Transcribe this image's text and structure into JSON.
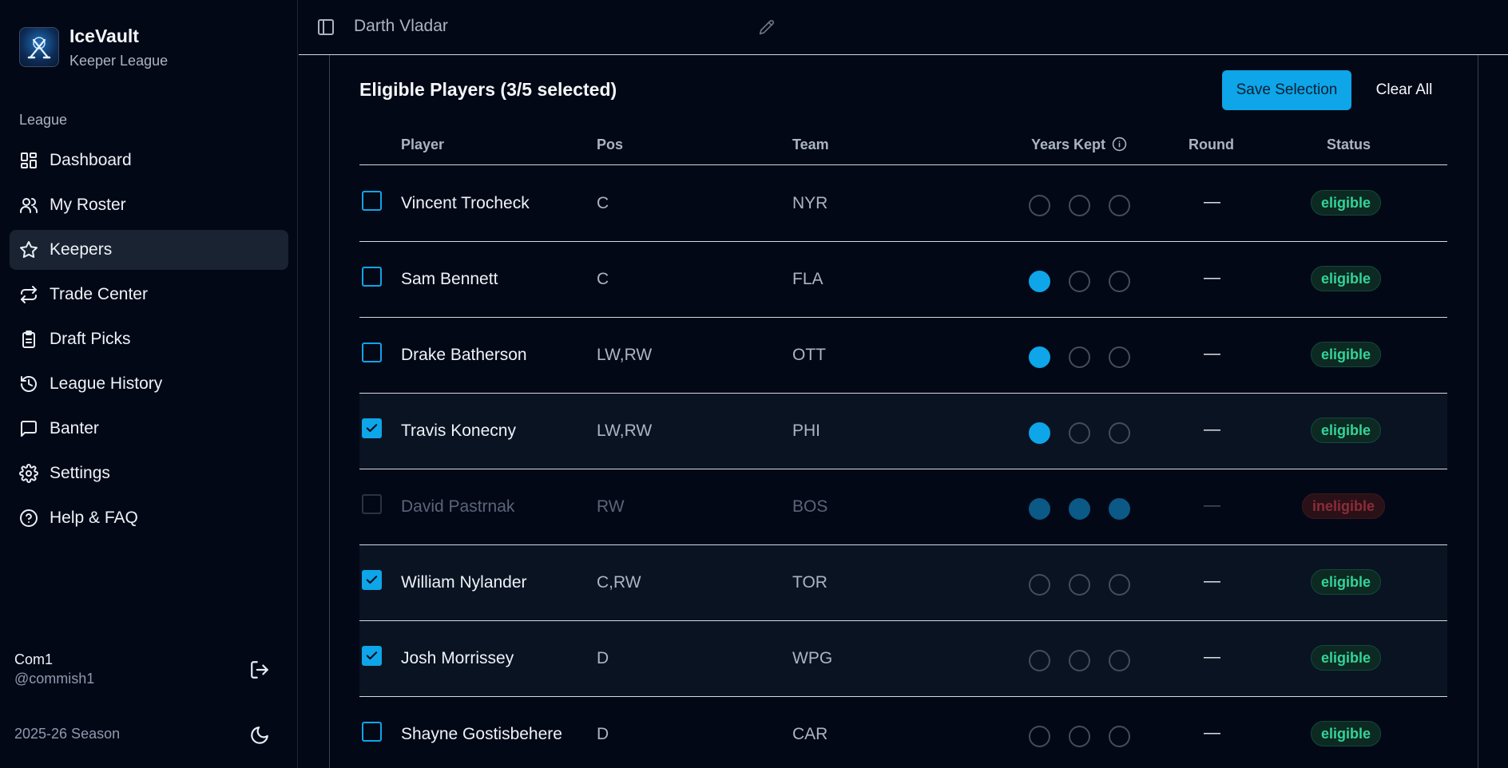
{
  "app": {
    "name": "IceVault",
    "subtitle": "Keeper League"
  },
  "sidebar": {
    "section_label": "League",
    "items": [
      {
        "label": "Dashboard",
        "icon": "dashboard-icon"
      },
      {
        "label": "My Roster",
        "icon": "users-icon"
      },
      {
        "label": "Keepers",
        "icon": "star-icon",
        "active": true
      },
      {
        "label": "Trade Center",
        "icon": "arrows-exchange-icon"
      },
      {
        "label": "Draft Picks",
        "icon": "clipboard-icon"
      },
      {
        "label": "League History",
        "icon": "history-icon"
      },
      {
        "label": "Banter",
        "icon": "chat-icon"
      },
      {
        "label": "Settings",
        "icon": "gear-icon"
      },
      {
        "label": "Help & FAQ",
        "icon": "help-icon"
      }
    ],
    "user": {
      "name": "Com1",
      "handle": "@commish1"
    },
    "season": "2025-26 Season"
  },
  "header": {
    "title": "Darth Vladar"
  },
  "keepers": {
    "title": "Eligible Players (3/5 selected)",
    "save_label": "Save Selection",
    "clear_label": "Clear All",
    "columns": {
      "player": "Player",
      "pos": "Pos",
      "team": "Team",
      "years": "Years Kept",
      "round": "Round",
      "status": "Status"
    },
    "rows": [
      {
        "player": "Vincent Trocheck",
        "pos": "C",
        "team": "NYR",
        "years_kept": 0,
        "round": "—",
        "status": "eligible",
        "selected": false
      },
      {
        "player": "Sam Bennett",
        "pos": "C",
        "team": "FLA",
        "years_kept": 1,
        "round": "—",
        "status": "eligible",
        "selected": false
      },
      {
        "player": "Drake Batherson",
        "pos": "LW,RW",
        "team": "OTT",
        "years_kept": 1,
        "round": "—",
        "status": "eligible",
        "selected": false
      },
      {
        "player": "Travis Konecny",
        "pos": "LW,RW",
        "team": "PHI",
        "years_kept": 1,
        "round": "—",
        "status": "eligible",
        "selected": true
      },
      {
        "player": "David Pastrnak",
        "pos": "RW",
        "team": "BOS",
        "years_kept": 3,
        "round": "—",
        "status": "ineligible",
        "selected": false
      },
      {
        "player": "William Nylander",
        "pos": "C,RW",
        "team": "TOR",
        "years_kept": 0,
        "round": "—",
        "status": "eligible",
        "selected": true
      },
      {
        "player": "Josh Morrissey",
        "pos": "D",
        "team": "WPG",
        "years_kept": 0,
        "round": "—",
        "status": "eligible",
        "selected": true
      },
      {
        "player": "Shayne Gostisbehere",
        "pos": "D",
        "team": "CAR",
        "years_kept": 0,
        "round": "—",
        "status": "eligible",
        "selected": false
      }
    ]
  },
  "colors": {
    "accent": "#0ea5e9",
    "eligible": "#34d399",
    "ineligible": "#8b2c3a",
    "background": "#030816"
  }
}
